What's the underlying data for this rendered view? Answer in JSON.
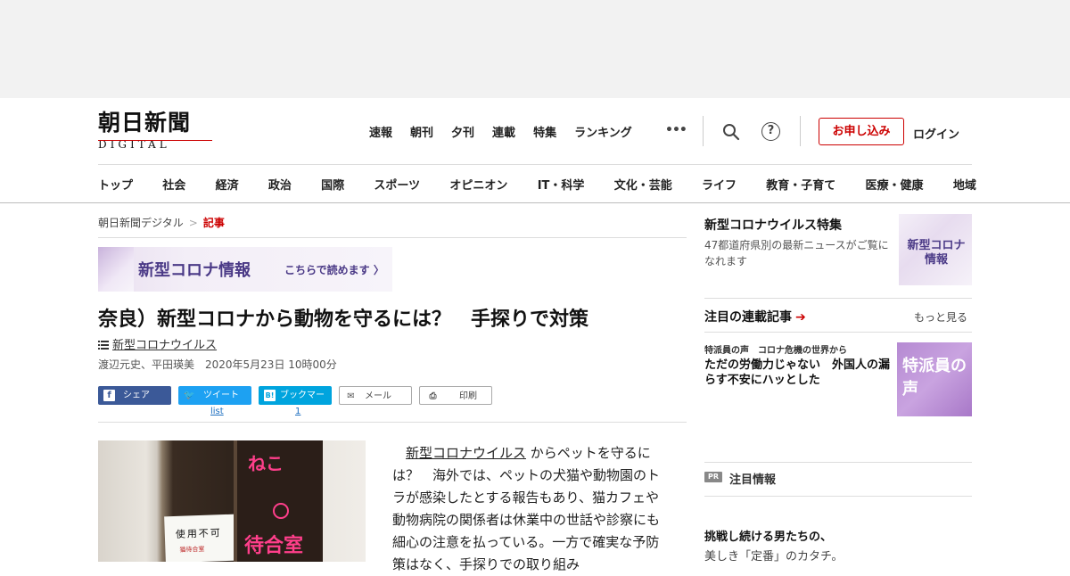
{
  "logo": {
    "title": "朝日新聞",
    "sub": "DIGITAL"
  },
  "topnav": [
    "速報",
    "朝刊",
    "夕刊",
    "連載",
    "特集",
    "ランキング"
  ],
  "header_actions": {
    "subscribe": "お申し込み",
    "login": "ログイン",
    "help": "?"
  },
  "catnav": [
    "トップ",
    "社会",
    "経済",
    "政治",
    "国際",
    "スポーツ",
    "オピニオン",
    "IT・科学",
    "文化・芸能",
    "ライフ",
    "教育・子育て",
    "医療・健康",
    "地域"
  ],
  "breadcrumb": {
    "home": "朝日新聞デジタル",
    "current": "記事"
  },
  "banner": {
    "title": "新型コロナ情報",
    "link": "こちらで読めます"
  },
  "article": {
    "headline": "奈良）新型コロナから動物を守るには？　手探りで対策",
    "topic": "新型コロナウイルス",
    "byline": "渡辺元史、平田瑛美　2020年5月23日 10時00分",
    "body_kw": "新型コロナウイルス",
    "body_rest": "からペットを守るには？　海外では、ペットの犬猫や動物園のトラが感染したとする報告もあり、猫カフェや動物病院の関係者は休業中の世話や診察にも細心の注意を払っている。一方で確実な予防策はなく、手探りでの取り組み"
  },
  "share": {
    "facebook": "シェア",
    "twitter": "ツイート",
    "hatena": "ブックマーク",
    "mail": "メール",
    "print": "印刷",
    "twitter_count": "list",
    "hatena_count": "1"
  },
  "photo": {
    "sign_top": "ねこ",
    "sign_bottom": "待合室",
    "paper_text": "使用不可",
    "paper_sub": "猫待合室"
  },
  "sidebar": {
    "feature_title": "新型コロナウイルス特集",
    "feature_desc": "47都道府県別の最新ニュースがご覧になれます",
    "feature_thumb": "新型コロナ情報",
    "serial_title": "注目の連載記事",
    "more": "もっと見る",
    "serial_kicker": "特派員の声　コロナ危機の世界から",
    "serial_headline": "ただの労働力じゃない　外国人の漏らす不安にハッとした",
    "serial_thumb": "特派員の声",
    "pr_badge": "PR",
    "pr_title": "注目情報",
    "pr_headline": "挑戦し続ける男たちの、",
    "pr_sub": "美しき「定番」のカタチ。"
  },
  "colors": {
    "accent": "#cc0000",
    "banner_text": "#4b3a87",
    "facebook": "#3b5998",
    "twitter": "#1da1f2",
    "hatena": "#00a4de"
  }
}
